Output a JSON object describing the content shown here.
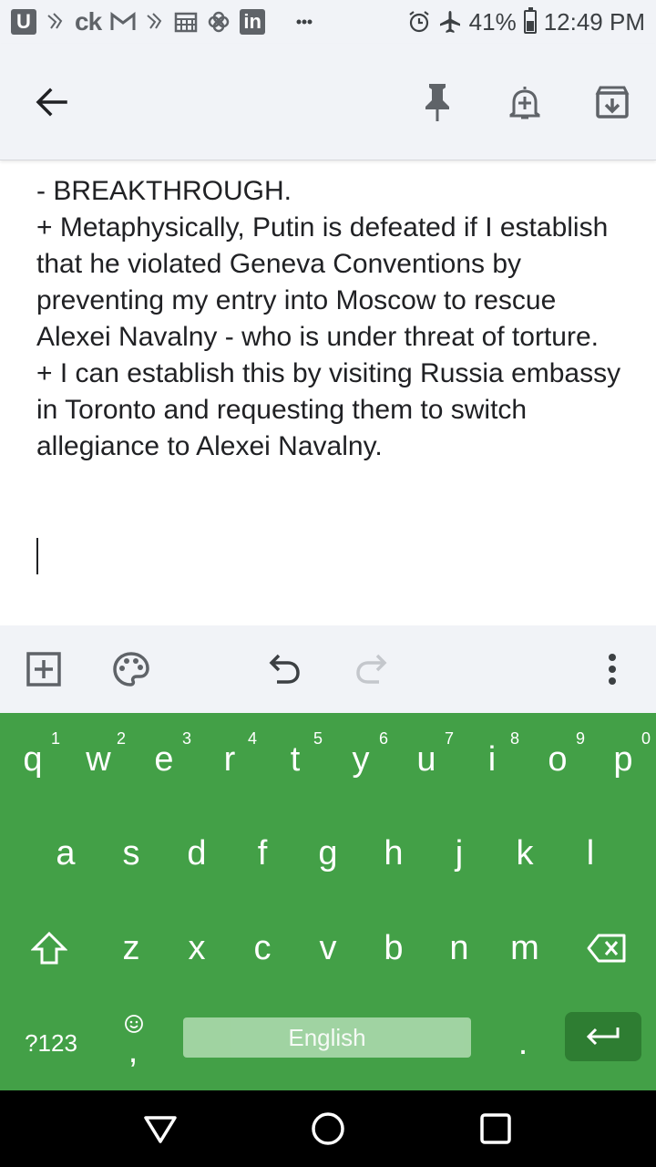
{
  "status_bar": {
    "left_text": "ck",
    "in_text": "in",
    "battery_percent": "41%",
    "time": "12:49 PM",
    "icons": [
      "u-icon",
      "notification-icon",
      "gmail-icon",
      "calendar-icon",
      "pinwheel-icon",
      "linkedin-icon",
      "more-dots-icon",
      "alarm-icon",
      "airplane-icon",
      "battery-icon"
    ]
  },
  "app_bar": {
    "icons": [
      "back-arrow-icon",
      "pin-icon",
      "add-reminder-icon",
      "archive-icon"
    ]
  },
  "note": {
    "lines": [
      "- BREAKTHROUGH.",
      "+ Metaphysically, Putin is defeated if I establish that he violated Geneva Conventions by preventing my entry into Moscow to rescue Alexei Navalny - who is under threat of torture.",
      "+ I can establish this by visiting Russia embassy in Toronto and requesting them to switch allegiance to Alexei Navalny."
    ]
  },
  "editor_toolbar": {
    "icons": [
      "add-box-icon",
      "palette-icon",
      "undo-icon",
      "redo-icon",
      "more-vert-icon"
    ]
  },
  "keyboard": {
    "row1": [
      {
        "key": "q",
        "hint": "1"
      },
      {
        "key": "w",
        "hint": "2"
      },
      {
        "key": "e",
        "hint": "3"
      },
      {
        "key": "r",
        "hint": "4"
      },
      {
        "key": "t",
        "hint": "5"
      },
      {
        "key": "y",
        "hint": "6"
      },
      {
        "key": "u",
        "hint": "7"
      },
      {
        "key": "i",
        "hint": "8"
      },
      {
        "key": "o",
        "hint": "9"
      },
      {
        "key": "p",
        "hint": "0"
      }
    ],
    "row2": [
      "a",
      "s",
      "d",
      "f",
      "g",
      "h",
      "j",
      "k",
      "l"
    ],
    "row3": [
      "z",
      "x",
      "c",
      "v",
      "b",
      "n",
      "m"
    ],
    "symbols_label": "?123",
    "comma_label": ",",
    "space_label": "English",
    "period_label": ".",
    "color": "#43a047"
  },
  "nav_bar": {
    "icons": [
      "back-triangle-icon",
      "home-circle-icon",
      "recents-square-icon"
    ]
  }
}
